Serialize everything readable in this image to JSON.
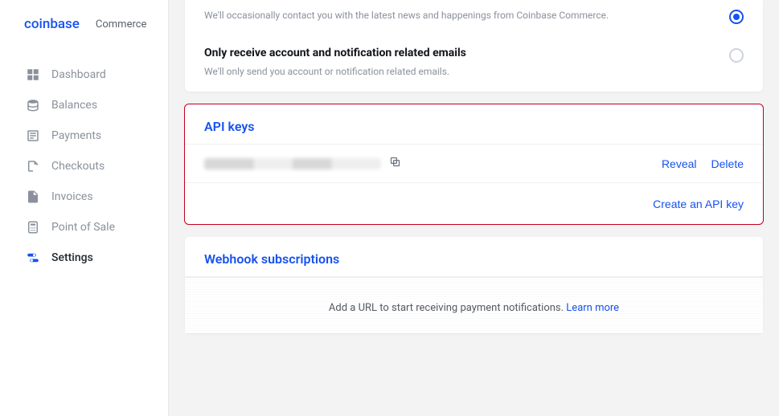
{
  "brand": {
    "name": "coinbase",
    "sub": "Commerce"
  },
  "sidebar": {
    "items": [
      {
        "label": "Dashboard"
      },
      {
        "label": "Balances"
      },
      {
        "label": "Payments"
      },
      {
        "label": "Checkouts"
      },
      {
        "label": "Invoices"
      },
      {
        "label": "Point of Sale"
      },
      {
        "label": "Settings"
      }
    ]
  },
  "emails": {
    "opt1_title": "",
    "opt1_desc": "We'll occasionally contact you with the latest news and happenings from Coinbase Commerce.",
    "opt2_title": "Only receive account and notification related emails",
    "opt2_desc": "We'll only send you account or notification related emails."
  },
  "api": {
    "heading": "API keys",
    "reveal": "Reveal",
    "delete": "Delete",
    "create": "Create an API key"
  },
  "webhook": {
    "heading": "Webhook subscriptions",
    "body_a": "Add a URL to start receiving payment notifications. ",
    "link": "Learn more"
  }
}
